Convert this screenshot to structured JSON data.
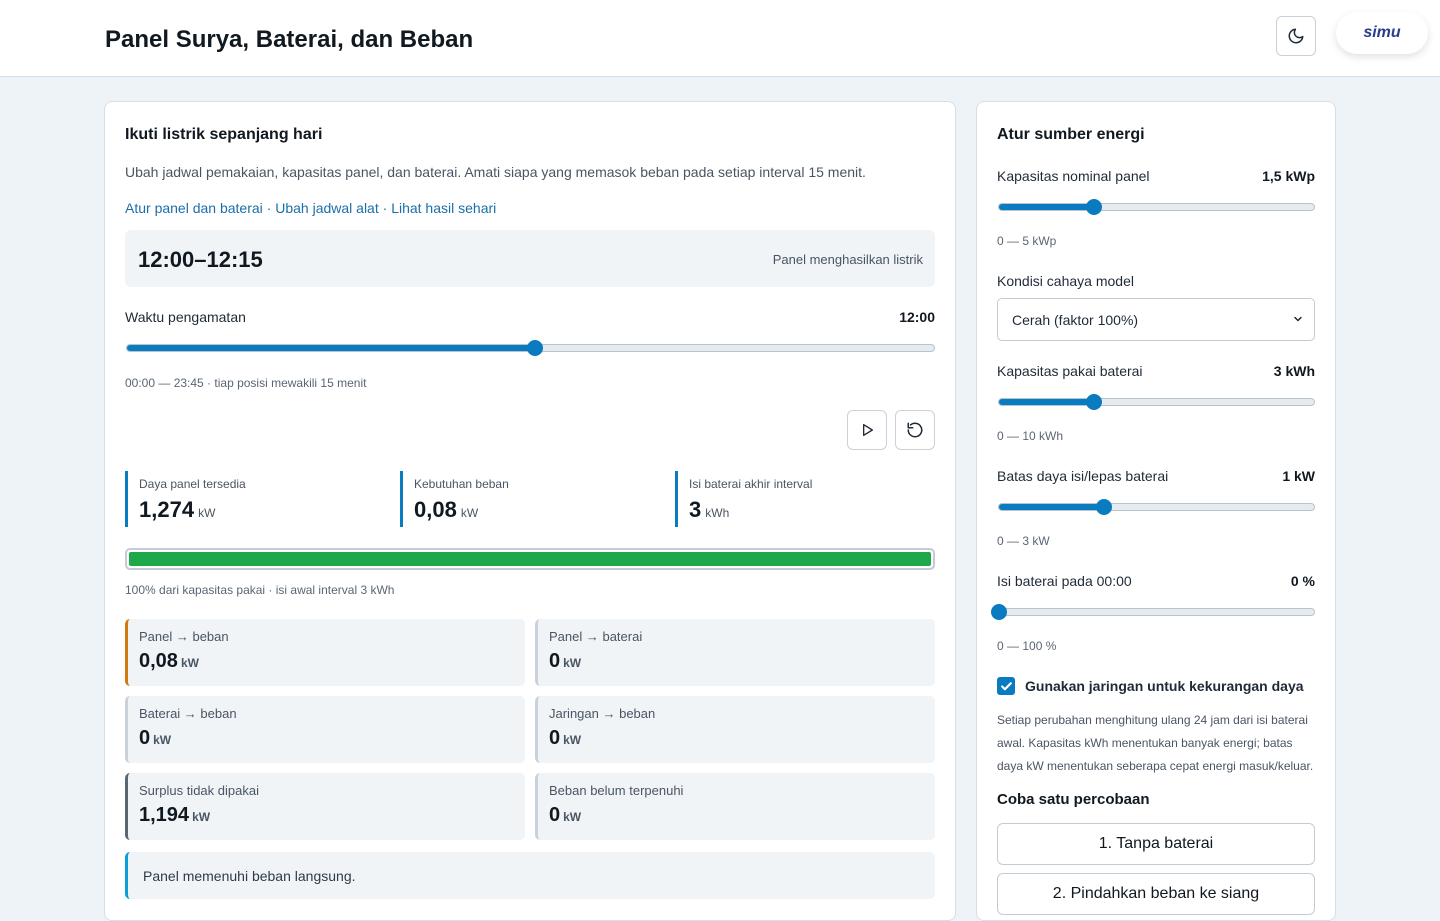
{
  "header": {
    "title": "Panel Surya, Baterai, dan Beban",
    "logo_text": "simu"
  },
  "main": {
    "heading": "Ikuti listrik sepanjang hari",
    "description": "Ubah jadwal pemakaian, kapasitas panel, dan baterai. Amati siapa yang memasok beban pada setiap interval 15 menit.",
    "links": [
      "Atur panel dan baterai",
      "Ubah jadwal alat",
      "Lihat hasil sehari"
    ],
    "link_separator": " · ",
    "interval": "12:00–12:15",
    "interval_status": "Panel menghasilkan listrik",
    "time_slider": {
      "label": "Waktu pengamatan",
      "value": "12:00",
      "fraction": 0.5053,
      "hint": "00:00 — 23:45 · tiap posisi mewakili 15 menit"
    },
    "stats": [
      {
        "label": "Daya panel tersedia",
        "value": "1,274",
        "unit": "kW"
      },
      {
        "label": "Kebutuhan beban",
        "value": "0,08",
        "unit": "kW"
      },
      {
        "label": "Isi baterai akhir interval",
        "value": "3",
        "unit": "kWh"
      }
    ],
    "battery_percent": 100,
    "battery_hint": "100% dari kapasitas pakai · isi awal interval 3 kWh",
    "flows": [
      {
        "label": "Panel → beban",
        "value": "0,08",
        "unit": "kW",
        "accent": "#d17a12"
      },
      {
        "label": "Panel → baterai",
        "value": "0",
        "unit": "kW",
        "accent": "#c9d2db"
      },
      {
        "label": "Baterai → beban",
        "value": "0",
        "unit": "kW",
        "accent": "#c9d2db"
      },
      {
        "label": "Jaringan → beban",
        "value": "0",
        "unit": "kW",
        "accent": "#c9d2db"
      },
      {
        "label": "Surplus tidak dipakai",
        "value": "1,194",
        "unit": "kW",
        "accent": "#5b6674"
      },
      {
        "label": "Beban belum terpenuhi",
        "value": "0",
        "unit": "kW",
        "accent": "#c9d2db"
      }
    ],
    "note": "Panel memenuhi beban langsung."
  },
  "side": {
    "heading": "Atur sumber energi",
    "panel_capacity": {
      "label": "Kapasitas nominal panel",
      "value": "1,5 kWp",
      "fraction": 0.3,
      "range": "0 — 5 kWp"
    },
    "light_condition": {
      "label": "Kondisi cahaya model",
      "selected": "Cerah (faktor 100%)"
    },
    "battery_capacity": {
      "label": "Kapasitas pakai baterai",
      "value": "3 kWh",
      "fraction": 0.3,
      "range": "0 — 10 kWh"
    },
    "battery_power": {
      "label": "Batas daya isi/lepas baterai",
      "value": "1 kW",
      "fraction": 0.3333,
      "range": "0 — 3 kW"
    },
    "battery_initial": {
      "label": "Isi baterai pada 00:00",
      "value": "0 %",
      "fraction": 0.0,
      "range": "0 — 100 %"
    },
    "grid_checkbox": {
      "label": "Gunakan jaringan untuk kekurangan daya",
      "checked": true
    },
    "explanation": "Setiap perubahan menghitung ulang 24 jam dari isi baterai awal. Kapasitas kWh menentukan banyak energi; batas daya kW menentukan seberapa cepat energi masuk/keluar.",
    "experiments_heading": "Coba satu percobaan",
    "experiments": [
      "1. Tanpa baterai",
      "2. Pindahkan beban ke siang"
    ]
  },
  "colors": {
    "accent": "#0a7bc1",
    "battery": "#1ea84a"
  }
}
